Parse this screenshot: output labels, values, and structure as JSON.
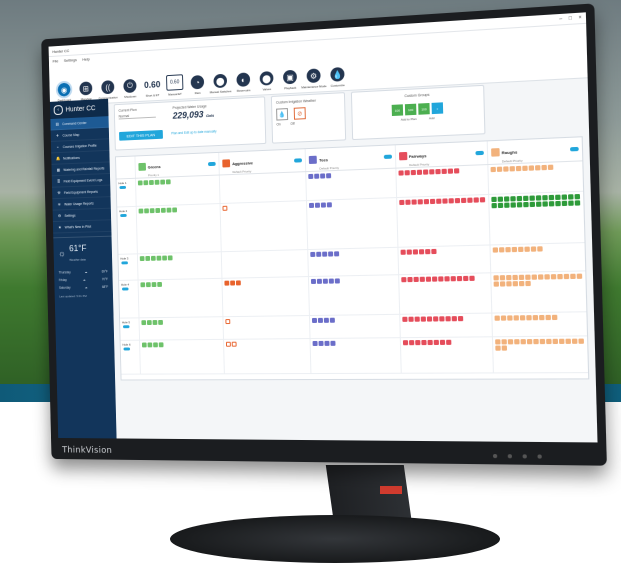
{
  "window": {
    "title": "Hunter CC",
    "menu": [
      "File",
      "Settings",
      "Help"
    ]
  },
  "toolbar": {
    "tools": [
      {
        "label": "Dashboard",
        "icon": "dashboard-icon",
        "glyph": "◉",
        "kind": "active"
      },
      {
        "label": "Mapview",
        "icon": "map-icon",
        "glyph": "⊞",
        "kind": "icon"
      },
      {
        "label": "Communication",
        "icon": "communication-icon",
        "glyph": "((",
        "kind": "icon"
      },
      {
        "label": "Shutdown",
        "icon": "shutdown-icon",
        "glyph": "⏻",
        "kind": "icon"
      },
      {
        "label": "Short & ET",
        "icon": "et-value",
        "glyph": "0.60",
        "kind": "num"
      },
      {
        "label": "Manual ET",
        "icon": "manual-et-box",
        "glyph": "0.60",
        "kind": "box"
      },
      {
        "label": "Rain",
        "icon": "rain-icon",
        "glyph": "◔",
        "kind": "icon"
      },
      {
        "label": "Manual Switches",
        "icon": "manual-switch-icon",
        "glyph": "⬤",
        "kind": "icon"
      },
      {
        "label": "Reservoirs",
        "icon": "reservoir-icon",
        "glyph": "◐",
        "kind": "icon"
      },
      {
        "label": "Valves",
        "icon": "valve-icon",
        "glyph": "⬤",
        "kind": "icon"
      },
      {
        "label": "Playback",
        "icon": "playback-icon",
        "glyph": "▣",
        "kind": "icon"
      },
      {
        "label": "Maintenance Mode",
        "icon": "maintenance-icon",
        "glyph": "⚙",
        "kind": "icon"
      },
      {
        "label": "Customize",
        "icon": "drop-icon",
        "glyph": "💧",
        "kind": "icon"
      }
    ]
  },
  "sidebar": {
    "course_name": "Hunter CC",
    "items": [
      {
        "label": "Command Center",
        "icon": "command-icon",
        "active": true
      },
      {
        "label": "Course Map",
        "icon": "map-icon",
        "active": false
      },
      {
        "label": "Courses Irrigation Profile",
        "icon": "profile-icon",
        "active": false
      },
      {
        "label": "Notifications",
        "icon": "bell-icon",
        "active": false
      },
      {
        "label": "Watering and Rainfall Reports",
        "icon": "report-icon",
        "active": false
      },
      {
        "label": "Field Equipment Event Logs",
        "icon": "log-icon",
        "active": false
      },
      {
        "label": "Field Equipment Reports",
        "icon": "equipment-icon",
        "active": false
      },
      {
        "label": "Water Usage Reports",
        "icon": "water-icon",
        "active": false
      },
      {
        "label": "Settings",
        "icon": "gear-icon",
        "active": false
      },
      {
        "label": "What's New in Pilot",
        "icon": "star-icon",
        "active": false
      }
    ],
    "weather": {
      "temp": "61°F",
      "sub": "Weather data"
    },
    "forecast": [
      {
        "day": "Thursday",
        "temp": "69°F"
      },
      {
        "day": "Friday",
        "temp": "70°F"
      },
      {
        "day": "Saturday",
        "temp": "68°F"
      }
    ],
    "updated": "Last updated: 5:01 PM"
  },
  "cards": {
    "plan": {
      "label": "Current Plan",
      "plan_value": "Normal",
      "usage_label": "Projected Water Usage",
      "usage_value": "229,093",
      "usage_unit": "Gals",
      "button": "EDIT THIS PLAN",
      "link": "Plan and Edit up to date manually"
    },
    "weather_mode": {
      "label": "Custom Irrigation Weather",
      "on": "On",
      "off": "Off"
    },
    "adjust": {
      "label": "Custom Groups",
      "labels": [
        "Add to Plan",
        "Add"
      ],
      "tiles": [
        "100",
        "100",
        "100",
        "+"
      ]
    }
  },
  "schedule": {
    "columns": [
      {
        "name": "Greens",
        "priority": "Priority 1",
        "color": "#6ec26a"
      },
      {
        "name": "Aggressive",
        "priority": "Default Priority",
        "color": "#e8632d"
      },
      {
        "name": "Tees",
        "priority": "Default Priority",
        "color": "#6b6ec9"
      },
      {
        "name": "Fairways",
        "priority": "Default Priority",
        "color": "#e54d5b"
      },
      {
        "name": "Roughs",
        "priority": "Default Priority",
        "color": "#f2b27c"
      }
    ],
    "holes": [
      "Hole 1",
      "Hole 2",
      "Hole 3",
      "Hole 4",
      "Hole 5",
      "Hole 6"
    ]
  }
}
